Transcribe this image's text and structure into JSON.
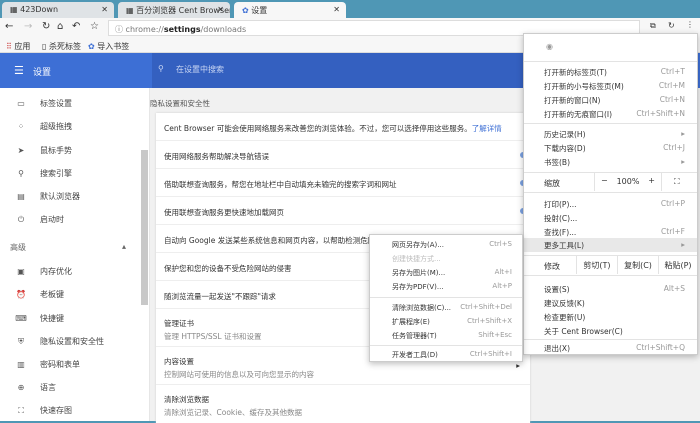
{
  "tabs": [
    {
      "label": "423Down"
    },
    {
      "label": "百分浏览器 Cent Browser"
    },
    {
      "label": "设置"
    }
  ],
  "toolbar": {
    "url_prefix": "chrome://",
    "url_bold": "settings",
    "url_suffix": "/downloads"
  },
  "bookmarks": [
    {
      "label": "应用"
    },
    {
      "label": "杀死标签"
    },
    {
      "label": "导入书签"
    }
  ],
  "header": {
    "title": "设置",
    "search_placeholder": "在设置中搜索"
  },
  "sidebar": {
    "items": [
      {
        "label": "标签设置",
        "icon": "tab-icon"
      },
      {
        "label": "超级拖拽",
        "icon": "drag-icon"
      },
      {
        "label": "鼠标手势",
        "icon": "cursor-icon"
      },
      {
        "label": "搜索引擎",
        "icon": "search-icon"
      },
      {
        "label": "默认浏览器",
        "icon": "browser-icon"
      },
      {
        "label": "启动时",
        "icon": "power-icon"
      }
    ],
    "advanced_label": "高级",
    "advanced_items": [
      {
        "label": "内存优化",
        "icon": "chip-icon"
      },
      {
        "label": "老板键",
        "icon": "alarm-icon"
      },
      {
        "label": "快捷键",
        "icon": "keyboard-icon"
      },
      {
        "label": "隐私设置和安全性",
        "icon": "shield-icon"
      },
      {
        "label": "密码和表单",
        "icon": "clipboard-icon"
      },
      {
        "label": "语言",
        "icon": "globe-icon"
      },
      {
        "label": "快速存图",
        "icon": "image-icon"
      }
    ]
  },
  "main": {
    "section_title": "隐私设置和安全性",
    "intro": "Cent Browser 可能会使用网络服务来改善您的浏览体验。不过，您可以选择停用这些服务。",
    "learn_more": "了解详情",
    "rows": [
      {
        "title": "使用网络服务帮助解决导航错误"
      },
      {
        "title": "借助联想查询服务，帮您在地址栏中自动填充未输完的搜索字词和网址"
      },
      {
        "title": "使用联想查询服务更快速地加载网页"
      },
      {
        "title": "自动向 Google 发送某些系统信息和网页内容，以帮助检测危险"
      },
      {
        "title": "保护您和您的设备不受危险网站的侵害"
      },
      {
        "title": "随浏览流量一起发送\"不跟踪\"请求"
      },
      {
        "title": "管理证书",
        "subtitle": "管理 HTTPS/SSL 证书和设置"
      },
      {
        "title": "内容设置",
        "subtitle": "控制网站可使用的信息以及可向您显示的内容"
      },
      {
        "title": "清除浏览数据",
        "subtitle": "清除浏览记录、Cookie、缓存及其他数据"
      }
    ]
  },
  "menu": {
    "group1": [
      {
        "label": "打开新的标签页(T)",
        "key": "Ctrl+T"
      },
      {
        "label": "打开新的小号标签页(M)",
        "key": "Ctrl+M"
      },
      {
        "label": "打开新的窗口(N)",
        "key": "Ctrl+N"
      },
      {
        "label": "打开新的无痕窗口(I)",
        "key": "Ctrl+Shift+N"
      }
    ],
    "group2": [
      {
        "label": "历史记录(H)",
        "key": "▸"
      },
      {
        "label": "下载内容(D)",
        "key": "Ctrl+J"
      },
      {
        "label": "书签(B)",
        "key": "▸"
      }
    ],
    "zoom": {
      "label": "缩放",
      "minus": "−",
      "value": "100%",
      "plus": "+"
    },
    "group3": [
      {
        "label": "打印(P)...",
        "key": "Ctrl+P"
      },
      {
        "label": "投射(C)...",
        "key": ""
      },
      {
        "label": "查找(F)...",
        "key": "Ctrl+F"
      },
      {
        "label": "更多工具(L)",
        "key": "▸"
      }
    ],
    "edit": {
      "label": "修改",
      "cut": "剪切(T)",
      "copy": "复制(C)",
      "paste": "粘贴(P)"
    },
    "group4": [
      {
        "label": "设置(S)",
        "key": "Alt+S"
      },
      {
        "label": "建议反馈(K)",
        "key": ""
      },
      {
        "label": "检查更新(U)",
        "key": ""
      },
      {
        "label": "关于 Cent Browser(C)",
        "key": ""
      }
    ],
    "exit": {
      "label": "退出(X)",
      "key": "Ctrl+Shift+Q"
    }
  },
  "submenu": {
    "items": [
      {
        "label": "网页另存为(A)...",
        "key": "Ctrl+S"
      },
      {
        "label": "创建快捷方式...",
        "key": ""
      },
      {
        "label": "另存为图片(M)...",
        "key": "Alt+I"
      },
      {
        "label": "另存为PDF(V)...",
        "key": "Alt+P"
      },
      {
        "label": "清除浏览数据(C)...",
        "key": "Ctrl+Shift+Del"
      },
      {
        "label": "扩展程序(E)",
        "key": "Ctrl+Shift+X"
      },
      {
        "label": "任务管理器(T)",
        "key": "Shift+Esc"
      },
      {
        "label": "开发者工具(D)",
        "key": "Ctrl+Shift+I"
      }
    ]
  },
  "colors": {
    "header": "#3d6fd5",
    "search": "#3460c0",
    "link": "#3d6fd5"
  }
}
